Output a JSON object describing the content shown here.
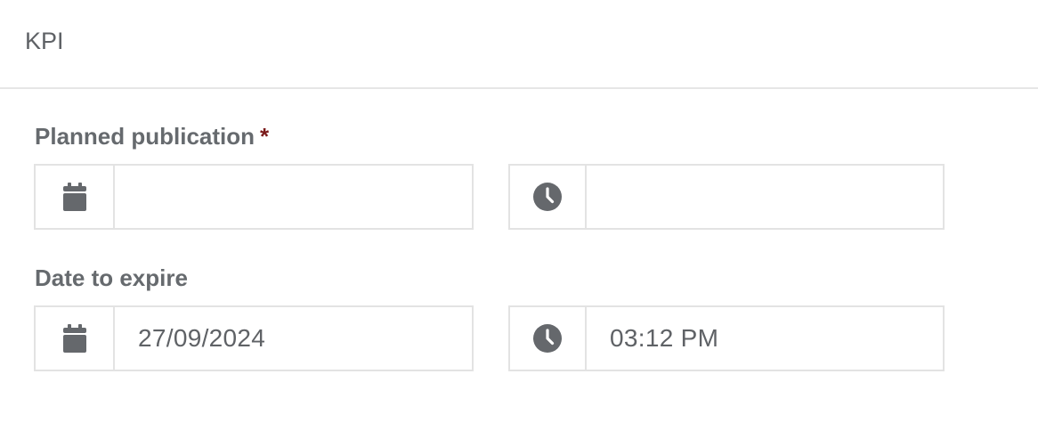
{
  "header": {
    "title": "KPI"
  },
  "planned_publication": {
    "label": "Planned publication",
    "required_mark": "*",
    "date_value": "",
    "time_value": ""
  },
  "date_to_expire": {
    "label": "Date to expire",
    "date_value": "27/09/2024",
    "time_value": "03:12 PM"
  },
  "icons": {
    "date": "calendar-icon",
    "time": "clock-icon"
  },
  "colors": {
    "text": "#5f6266",
    "required": "#7a1a1a",
    "border": "#e3e3e3",
    "icon": "#65686c"
  }
}
